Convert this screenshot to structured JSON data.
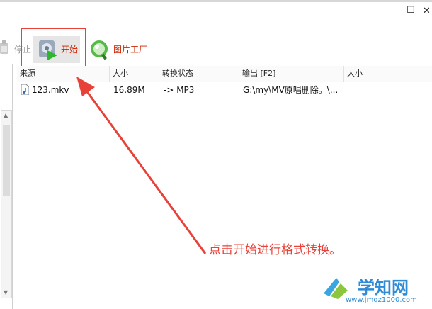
{
  "window": {
    "minimize_glyph": "—",
    "maximize_glyph": "☐",
    "close_glyph": "✕"
  },
  "toolbar": {
    "stop_label": "停止",
    "start_label": "开始",
    "picture_factory_label": "图片工厂"
  },
  "table": {
    "headers": [
      "来源",
      "大小",
      "转换状态",
      "输出 [F2]",
      "大小"
    ],
    "rows": [
      {
        "source": "123.mkv",
        "size": "16.89M",
        "status": "-> MP3",
        "output": "G:\\my\\MV原唱删除。\\...",
        "out_size": ""
      }
    ]
  },
  "annotation": {
    "text": "点击开始进行格式转换。",
    "color": "#e8413a"
  },
  "watermark": {
    "text": "学知网",
    "url": "www.jmqz1000.com"
  },
  "colors": {
    "accent_red": "#e8413a",
    "start_label": "#cc2200",
    "watermark_blue": "#2f8bd6"
  },
  "icons": {
    "file": "audio-file-icon",
    "stop": "stop-icon",
    "start": "start-icon",
    "picture": "picture-factory-icon"
  }
}
